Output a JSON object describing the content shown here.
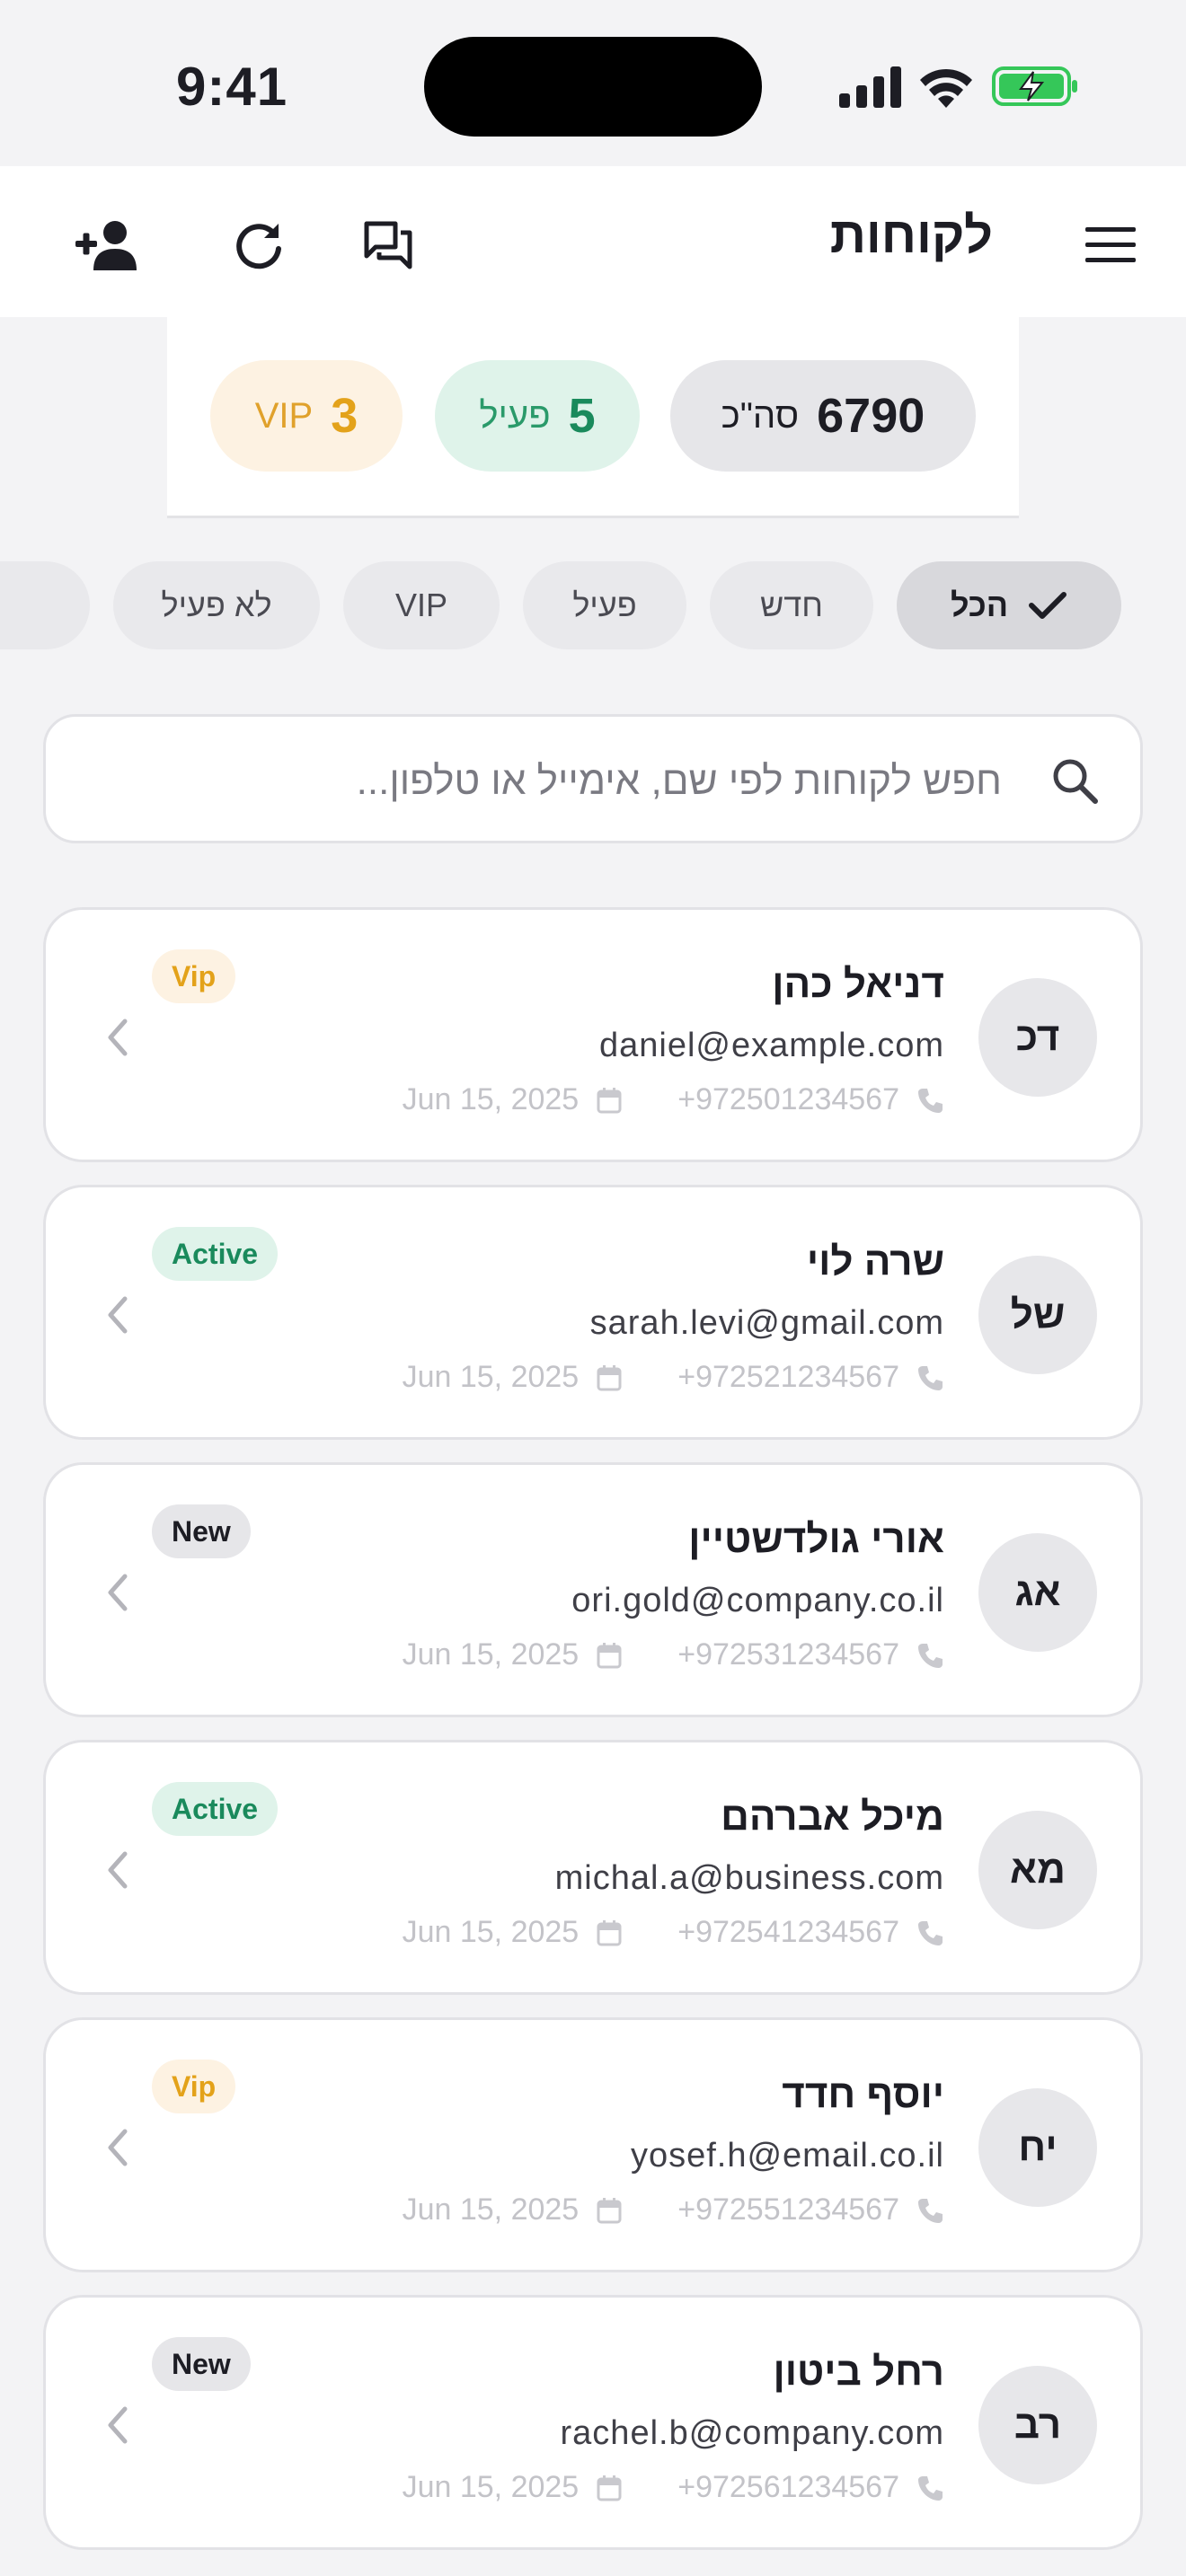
{
  "status_bar": {
    "time": "9:41"
  },
  "header": {
    "title": "לקוחות",
    "icons": [
      "menu-icon",
      "chat-icon",
      "refresh-icon",
      "add-user-icon"
    ]
  },
  "stats": {
    "total": {
      "value": "6790",
      "label": "סה\"כ"
    },
    "active": {
      "value": "5",
      "label": "פעיל"
    },
    "vip": {
      "value": "3",
      "label": "VIP"
    }
  },
  "filters": {
    "selected": "הכל",
    "chips": [
      {
        "label": "הכל",
        "selected": true
      },
      {
        "label": "חדש",
        "selected": false
      },
      {
        "label": "פעיל",
        "selected": false
      },
      {
        "label": "VIP",
        "selected": false
      },
      {
        "label": "לא פעיל",
        "selected": false
      }
    ]
  },
  "search": {
    "value": "",
    "placeholder": "חפש לקוחות לפי שם, אימייל או טלפון..."
  },
  "customers": [
    {
      "initials": "דכ",
      "name": "דניאל כהן",
      "email": "daniel@example.com",
      "phone": "972501234567+",
      "date": "Jun 15, 2025",
      "badge": "Vip"
    },
    {
      "initials": "של",
      "name": "שרה לוי",
      "email": "sarah.levi@gmail.com",
      "phone": "972521234567+",
      "date": "Jun 15, 2025",
      "badge": "Active"
    },
    {
      "initials": "אג",
      "name": "אורי גולדשטיין",
      "email": "ori.gold@company.co.il",
      "phone": "972531234567+",
      "date": "Jun 15, 2025",
      "badge": "New"
    },
    {
      "initials": "מא",
      "name": "מיכל אברהם",
      "email": "michal.a@business.com",
      "phone": "972541234567+",
      "date": "Jun 15, 2025",
      "badge": "Active"
    },
    {
      "initials": "יח",
      "name": "יוסף חדד",
      "email": "yosef.h@email.co.il",
      "phone": "972551234567+",
      "date": "Jun 15, 2025",
      "badge": "Vip"
    },
    {
      "initials": "רב",
      "name": "רחל ביטון",
      "email": "rachel.b@company.com",
      "phone": "972561234567+",
      "date": "Jun 15, 2025",
      "badge": "New"
    }
  ],
  "colors": {
    "background": "#f3f3f5",
    "active_green": "#1a8a5c",
    "vip_orange": "#e3a21a",
    "battery_green": "#35c759"
  }
}
